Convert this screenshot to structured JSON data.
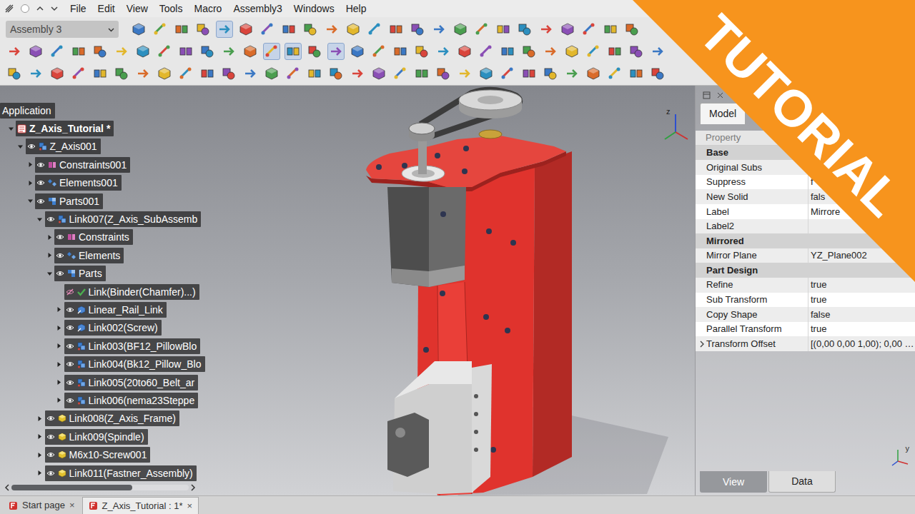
{
  "menu": {
    "items": [
      "File",
      "Edit",
      "View",
      "Tools",
      "Macro",
      "Assembly3",
      "Windows",
      "Help"
    ]
  },
  "toolbar": {
    "workbench": "Assembly 3",
    "rows": [
      [
        {
          "pressed": false
        },
        {
          "pressed": false
        },
        {
          "pressed": false
        },
        {
          "pressed": false
        },
        {
          "pressed": true
        },
        {
          "pressed": false
        },
        {
          "pressed": false
        },
        {
          "pressed": false
        },
        {
          "pressed": false
        },
        {
          "pressed": false
        },
        {
          "pressed": false
        },
        {
          "pressed": false
        },
        {
          "pressed": false
        },
        {
          "pressed": false
        },
        {
          "pressed": false
        },
        {
          "pressed": false
        },
        {
          "pressed": false
        },
        {
          "pressed": false
        },
        {
          "pressed": false
        },
        {
          "pressed": false
        },
        {
          "pressed": false
        },
        {
          "pressed": false
        },
        {
          "pressed": false
        },
        {
          "pressed": false
        }
      ],
      [
        {
          "pressed": false
        },
        {
          "pressed": false
        },
        {
          "pressed": false
        },
        {
          "pressed": false
        },
        {
          "pressed": false
        },
        {
          "pressed": false
        },
        {
          "pressed": false
        },
        {
          "pressed": false
        },
        {
          "pressed": false
        },
        {
          "pressed": false
        },
        {
          "pressed": false
        },
        {
          "pressed": false
        },
        {
          "pressed": true
        },
        {
          "pressed": true
        },
        {
          "pressed": false
        },
        {
          "pressed": true
        },
        {
          "pressed": false
        },
        {
          "pressed": false
        },
        {
          "pressed": false
        },
        {
          "pressed": false
        },
        {
          "pressed": false
        },
        {
          "pressed": false
        },
        {
          "pressed": false
        },
        {
          "pressed": false
        },
        {
          "pressed": false
        },
        {
          "pressed": false
        },
        {
          "pressed": false
        },
        {
          "pressed": false
        },
        {
          "pressed": false
        },
        {
          "pressed": false
        },
        {
          "pressed": false
        }
      ],
      [
        {
          "pressed": false
        },
        {
          "pressed": false
        },
        {
          "pressed": false
        },
        {
          "pressed": false
        },
        {
          "pressed": false
        },
        {
          "pressed": false
        },
        {
          "pressed": false
        },
        {
          "pressed": false
        },
        {
          "pressed": false
        },
        {
          "pressed": false
        },
        {
          "pressed": false
        },
        {
          "pressed": false
        },
        {
          "pressed": false
        },
        {
          "pressed": false
        },
        {
          "pressed": false
        },
        {
          "pressed": false
        },
        {
          "pressed": false
        },
        {
          "pressed": false
        },
        {
          "pressed": false
        },
        {
          "pressed": false
        },
        {
          "pressed": false
        },
        {
          "pressed": false
        },
        {
          "pressed": false
        },
        {
          "pressed": false
        },
        {
          "pressed": false
        },
        {
          "pressed": false
        },
        {
          "pressed": false
        },
        {
          "pressed": false
        },
        {
          "pressed": false
        },
        {
          "pressed": false
        },
        {
          "pressed": false
        }
      ]
    ]
  },
  "tree": {
    "header": "Application",
    "items": [
      {
        "label": "Z_Axis_Tutorial *",
        "level": 0,
        "kind": "document",
        "expandable": true,
        "expanded": true,
        "visible": true
      },
      {
        "label": "Z_Axis001",
        "level": 1,
        "kind": "assembly",
        "expandable": true,
        "expanded": true,
        "visible": true
      },
      {
        "label": "Constraints001",
        "level": 2,
        "kind": "constraints",
        "expandable": true,
        "expanded": false,
        "visible": true
      },
      {
        "label": "Elements001",
        "level": 2,
        "kind": "elements",
        "expandable": true,
        "expanded": false,
        "visible": true
      },
      {
        "label": "Parts001",
        "level": 2,
        "kind": "parts",
        "expandable": true,
        "expanded": true,
        "visible": true
      },
      {
        "label": "Link007(Z_Axis_SubAssemb",
        "level": 3,
        "kind": "assembly",
        "expandable": true,
        "expanded": true,
        "visible": true
      },
      {
        "label": "Constraints",
        "level": 4,
        "kind": "constraints",
        "expandable": true,
        "expanded": false,
        "visible": true
      },
      {
        "label": "Elements",
        "level": 4,
        "kind": "elements",
        "expandable": true,
        "expanded": false,
        "visible": true
      },
      {
        "label": "Parts",
        "level": 4,
        "kind": "parts",
        "expandable": true,
        "expanded": true,
        "visible": true
      },
      {
        "label": "Link(Binder(Chamfer)...)",
        "level": 5,
        "kind": "binder",
        "expandable": false,
        "expanded": false,
        "visible": false
      },
      {
        "label": "Linear_Rail_Link",
        "level": 5,
        "kind": "part-link",
        "expandable": true,
        "expanded": false,
        "visible": true
      },
      {
        "label": "Link002(Screw)",
        "level": 5,
        "kind": "part-link",
        "expandable": true,
        "expanded": false,
        "visible": true
      },
      {
        "label": "Link003(BF12_PillowBlo",
        "level": 5,
        "kind": "assembly",
        "expandable": true,
        "expanded": false,
        "visible": true
      },
      {
        "label": "Link004(Bk12_Pillow_Blo",
        "level": 5,
        "kind": "assembly",
        "expandable": true,
        "expanded": false,
        "visible": true
      },
      {
        "label": "Link005(20to60_Belt_ar",
        "level": 5,
        "kind": "assembly",
        "expandable": true,
        "expanded": false,
        "visible": true
      },
      {
        "label": "Link006(nema23Steppe",
        "level": 5,
        "kind": "assembly",
        "expandable": true,
        "expanded": false,
        "visible": true
      },
      {
        "label": "Link008(Z_Axis_Frame)",
        "level": 3,
        "kind": "part",
        "expandable": true,
        "expanded": false,
        "visible": true
      },
      {
        "label": "Link009(Spindle)",
        "level": 3,
        "kind": "part",
        "expandable": true,
        "expanded": false,
        "visible": true
      },
      {
        "label": "M6x10-Screw001",
        "level": 3,
        "kind": "part",
        "expandable": true,
        "expanded": false,
        "visible": true
      },
      {
        "label": "Link011(Fastner_Assembly)",
        "level": 3,
        "kind": "part",
        "expandable": true,
        "expanded": false,
        "visible": true
      }
    ],
    "hscroll_level": 0.68
  },
  "view": {
    "triad_top": "z",
    "triad_bottom": "y"
  },
  "properties": {
    "tabs": [
      {
        "label": "Model",
        "selected": true
      }
    ],
    "header": "Property",
    "rows": [
      {
        "kind": "group",
        "name": "Base",
        "value": "",
        "expandable": false,
        "expanded": false
      },
      {
        "kind": "property",
        "name": "Original Subs",
        "value": "[",
        "expandable": false,
        "expanded": false
      },
      {
        "kind": "property",
        "name": "Suppress",
        "value": "f",
        "expandable": false,
        "expanded": false
      },
      {
        "kind": "property",
        "name": "New Solid",
        "value": "fals",
        "expandable": false,
        "expanded": false
      },
      {
        "kind": "property",
        "name": "Label",
        "value": "Mirrore",
        "expandable": false,
        "expanded": false
      },
      {
        "kind": "property",
        "name": "Label2",
        "value": "",
        "expandable": false,
        "expanded": false
      },
      {
        "kind": "group",
        "name": "Mirrored",
        "value": "",
        "expandable": false,
        "expanded": false
      },
      {
        "kind": "property",
        "name": "Mirror Plane",
        "value": "YZ_Plane002",
        "expandable": false,
        "expanded": false
      },
      {
        "kind": "group",
        "name": "Part Design",
        "value": "",
        "expandable": false,
        "expanded": false
      },
      {
        "kind": "property",
        "name": "Refine",
        "value": "true",
        "expandable": false,
        "expanded": false
      },
      {
        "kind": "property",
        "name": "Sub Transform",
        "value": "true",
        "expandable": false,
        "expanded": false
      },
      {
        "kind": "property",
        "name": "Copy Shape",
        "value": "false",
        "expandable": false,
        "expanded": false
      },
      {
        "kind": "property",
        "name": "Parallel Transform",
        "value": "true",
        "expandable": false,
        "expanded": false
      },
      {
        "kind": "property",
        "name": "Transform Offset",
        "value": "[(0,00 0,00 1,00); 0,00 …",
        "expandable": true,
        "expanded": false
      }
    ],
    "bottom_tabs": [
      {
        "label": "View",
        "selected": false
      },
      {
        "label": "Data",
        "selected": true
      }
    ]
  },
  "doc_tabs": [
    {
      "label": "Start page",
      "close": "×",
      "selected": false
    },
    {
      "label": "Z_Axis_Tutorial : 1*",
      "close": "×",
      "selected": true
    }
  ],
  "banner": {
    "text": "TUTORIAL"
  }
}
